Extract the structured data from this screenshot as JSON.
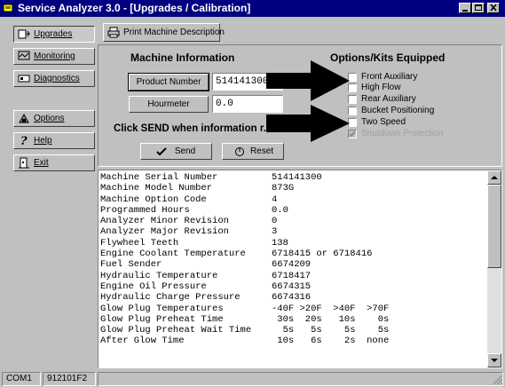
{
  "window": {
    "title": "Service Analyzer 3.0 - [Upgrades / Calibration]"
  },
  "sidebar": {
    "items": [
      {
        "label": "Upgrades",
        "icon": "upgrades-icon"
      },
      {
        "label": "Monitoring",
        "icon": "monitoring-icon"
      },
      {
        "label": "Diagnostics",
        "icon": "diagnostics-icon"
      },
      {
        "label": "Options",
        "icon": "options-icon"
      },
      {
        "label": "Help",
        "icon": "help-icon"
      },
      {
        "label": "Exit",
        "icon": "exit-icon"
      }
    ]
  },
  "toolbar": {
    "print_label": "Print Machine Description"
  },
  "machine": {
    "heading": "Machine Information",
    "product_number_label": "Product Number",
    "product_number_value": "514141300",
    "hourmeter_label": "Hourmeter",
    "hourmeter_value": "0.0",
    "send_prompt": "Click SEND when information r...",
    "send_label": "Send",
    "reset_label": "Reset"
  },
  "options": {
    "heading": "Options/Kits Equipped",
    "items": [
      {
        "label": "Front Auxiliary",
        "checked": false,
        "disabled": false
      },
      {
        "label": "High Flow",
        "checked": false,
        "disabled": false
      },
      {
        "label": "Rear Auxiliary",
        "checked": false,
        "disabled": false
      },
      {
        "label": "Bucket Positioning",
        "checked": false,
        "disabled": false
      },
      {
        "label": "Two Speed",
        "checked": false,
        "disabled": false
      },
      {
        "label": "Shutdown Protection",
        "checked": true,
        "disabled": true
      }
    ]
  },
  "output": {
    "rows": [
      {
        "key": "Machine Serial Number",
        "value": "514141300"
      },
      {
        "key": "Machine Model Number",
        "value": "873G"
      },
      {
        "key": "Machine Option Code",
        "value": "4"
      },
      {
        "key": "Programmed Hours",
        "value": "0.0"
      },
      {
        "key": "Analyzer Minor Revision",
        "value": "0"
      },
      {
        "key": "Analyzer Major Revision",
        "value": "3"
      },
      {
        "key": "Flywheel Teeth",
        "value": "138"
      },
      {
        "key": "Engine Coolant Temperature",
        "value": "6718415 or 6718416"
      },
      {
        "key": "Fuel Sender",
        "value": "6674209"
      },
      {
        "key": "Hydraulic Temperature",
        "value": "6718417"
      },
      {
        "key": "Engine Oil Pressure",
        "value": "6674315"
      },
      {
        "key": "Hydraulic Charge Pressure",
        "value": "6674316"
      },
      {
        "key": "Glow Plug Temperatures",
        "value": "-40F >20F  >40F  >70F"
      },
      {
        "key": "Glow Plug Preheat Time",
        "value": " 30s  20s   10s    0s"
      },
      {
        "key": "Glow Plug Preheat Wait Time",
        "value": "  5s   5s    5s    5s"
      },
      {
        "key": "After Glow Time",
        "value": " 10s   6s    2s  none"
      }
    ]
  },
  "status": {
    "port": "COM1",
    "code": "912101F2"
  },
  "colors": {
    "titlebar": "#000080",
    "face": "#c0c0c0",
    "annotation_arrow": "#000000"
  }
}
